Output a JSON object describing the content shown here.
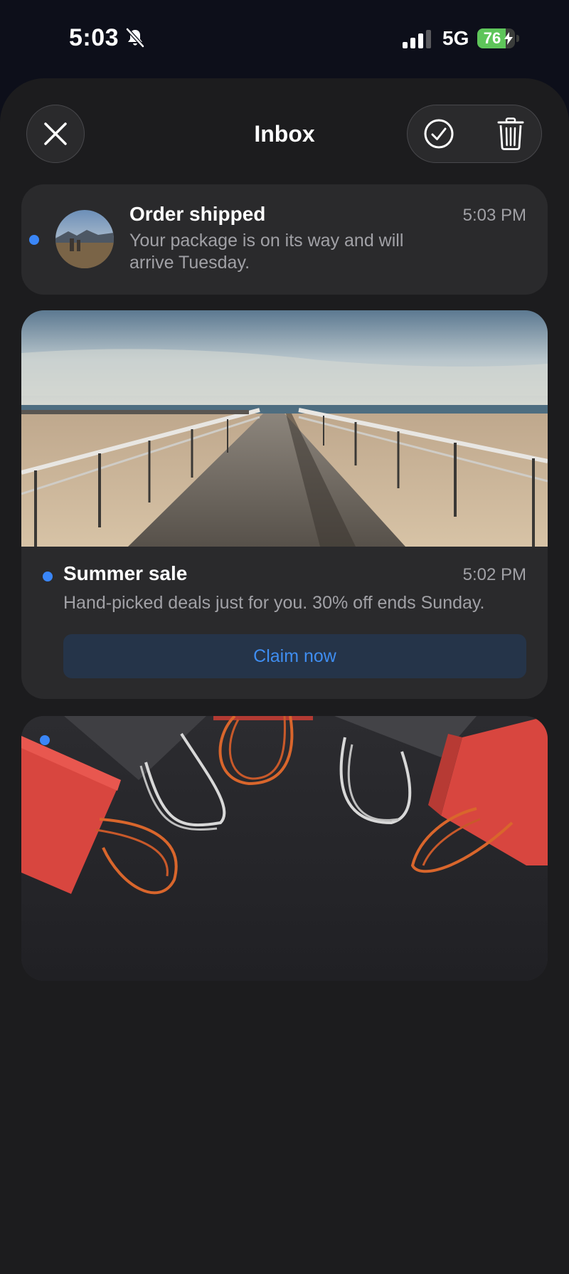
{
  "status_bar": {
    "time": "5:03",
    "network": "5G",
    "battery_level": "76",
    "icons": [
      "bell-slash-icon",
      "signal-icon",
      "battery-icon",
      "bolt-icon"
    ]
  },
  "header": {
    "title": "Inbox",
    "icons": [
      "close-icon",
      "checkmark-circle-icon",
      "trash-icon"
    ]
  },
  "messages": [
    {
      "title": "Order shipped",
      "time": "5:03 PM",
      "body": "Your package is on its way and will arrive Tuesday.",
      "unread": true
    },
    {
      "title": "Summer sale",
      "time": "5:02 PM",
      "body": "Hand-picked deals just for you. 30% off ends Sunday.",
      "button": "Claim now",
      "unread": true
    },
    {
      "unread": true
    }
  ],
  "colors": {
    "accent": "#3a86f7",
    "sheet": "#1c1c1e",
    "card": "#2a2a2c",
    "battery": "#5ec55a"
  }
}
